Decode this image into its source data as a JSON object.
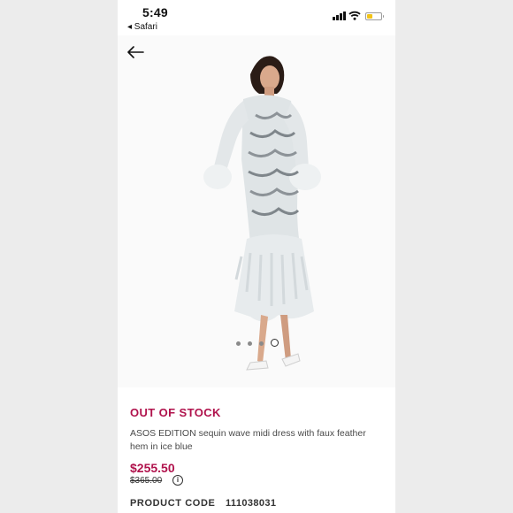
{
  "status_bar": {
    "time": "5:49",
    "back_to_app": "◂ Safari",
    "battery_level": 0.4,
    "battery_color": "#f2c318"
  },
  "header": {
    "back_icon": "arrow-left-icon"
  },
  "gallery": {
    "total_images": 4,
    "active_index": 3
  },
  "product": {
    "stock_status": "OUT OF STOCK",
    "name": "ASOS EDITION sequin wave midi dress with faux feather hem in ice blue",
    "price": "$255.50",
    "original_price": "$365.00",
    "price_info_icon": "info-icon",
    "info_glyph": "i",
    "product_code_label": "PRODUCT CODE",
    "product_code": "111038031"
  },
  "colors": {
    "accent": "#b0124c",
    "text": "#333333",
    "background": "#ececec"
  }
}
